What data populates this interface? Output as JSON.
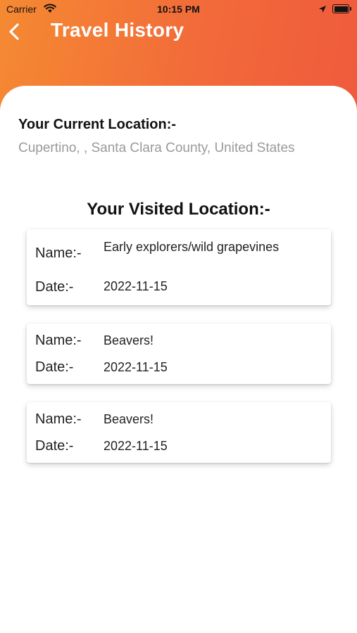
{
  "status_bar": {
    "carrier": "Carrier",
    "time": "10:15 PM",
    "icons": [
      "wifi-icon",
      "location-arrow-icon",
      "battery-icon"
    ]
  },
  "header": {
    "title": "Travel History",
    "back_icon": "chevron-left-icon",
    "gradient_colors": [
      "#f58a32",
      "#ef5a3c"
    ]
  },
  "current_location": {
    "label": "Your Current Location:-",
    "value": "Cupertino, , Santa Clara County, United States"
  },
  "visited": {
    "label": "Your Visited Location:-",
    "name_label": "Name:-",
    "date_label": "Date:-",
    "items": [
      {
        "name": "Early explorers/wild grapevines",
        "date": "2022-11-15"
      },
      {
        "name": "Beavers!",
        "date": "2022-11-15"
      },
      {
        "name": "Beavers!",
        "date": "2022-11-15"
      }
    ]
  }
}
